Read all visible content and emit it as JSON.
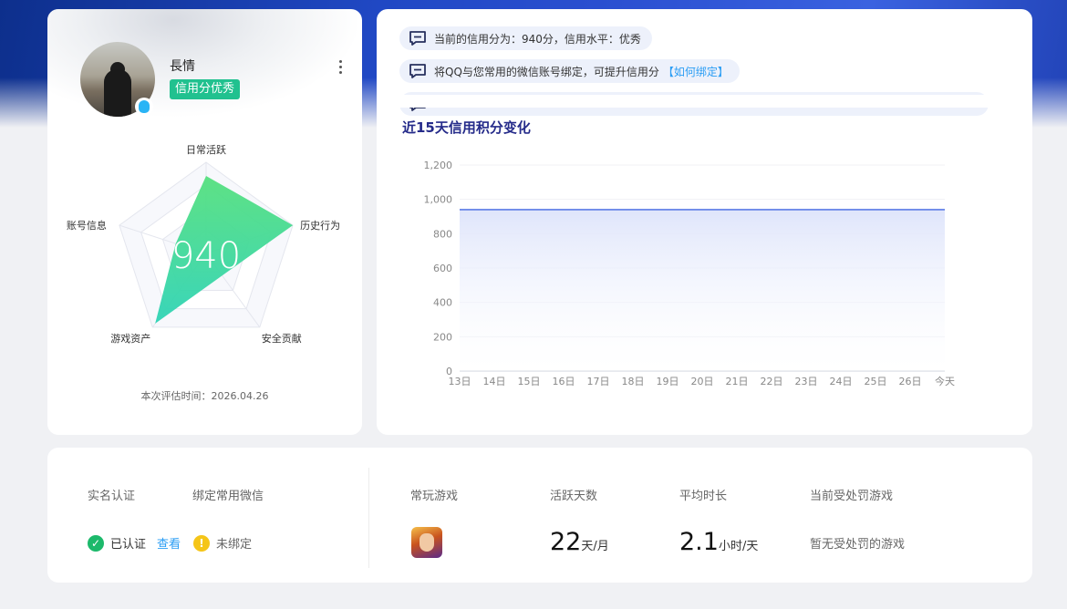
{
  "profile": {
    "nickname": "長情",
    "credit_tag": "信用分优秀",
    "score": "940",
    "eval_time": "本次评估时间：2026.04.26",
    "radar": {
      "axes": [
        "日常活跃",
        "历史行为",
        "安全贡献",
        "游戏资产",
        "账号信息"
      ],
      "values": [
        0.85,
        1.0,
        0.3,
        0.95,
        0.35
      ],
      "colors": {
        "from": "#56e07e",
        "to": "#2fd3b6"
      }
    }
  },
  "notices": [
    {
      "text": "当前的信用分为：940分，信用水平：优秀",
      "link": ""
    },
    {
      "text": "将QQ与您常用的微信账号绑定，可提升信用分",
      "link": "【如何绑定】"
    }
  ],
  "chart": {
    "title": "近15天信用积分变化",
    "chart_data": {
      "type": "area",
      "title": "近15天信用积分变化",
      "categories": [
        "13日",
        "14日",
        "15日",
        "16日",
        "17日",
        "18日",
        "19日",
        "20日",
        "21日",
        "22日",
        "23日",
        "24日",
        "25日",
        "26日",
        "今天"
      ],
      "values": [
        940,
        940,
        940,
        940,
        940,
        940,
        940,
        940,
        940,
        940,
        940,
        940,
        940,
        940,
        940
      ],
      "yticks": [
        "0",
        "200",
        "400",
        "600",
        "800",
        "1,000",
        "1,200"
      ],
      "ylim": [
        0,
        1200
      ],
      "grid": true,
      "line_color": "#5b7be6",
      "fill_color": "#dfe5fb"
    }
  },
  "bottom": {
    "realname_label": "实名认证",
    "realname_status": "已认证",
    "realname_view": "查看",
    "wechat_label": "绑定常用微信",
    "wechat_status": "未绑定",
    "game_label": "常玩游戏",
    "active_label": "活跃天数",
    "active_value": "22",
    "active_unit": "天/月",
    "avg_label": "平均时长",
    "avg_value": "2.1",
    "avg_unit": "小时/天",
    "penalty_label": "当前受处罚游戏",
    "penalty_value": "暂无受处罚的游戏"
  }
}
